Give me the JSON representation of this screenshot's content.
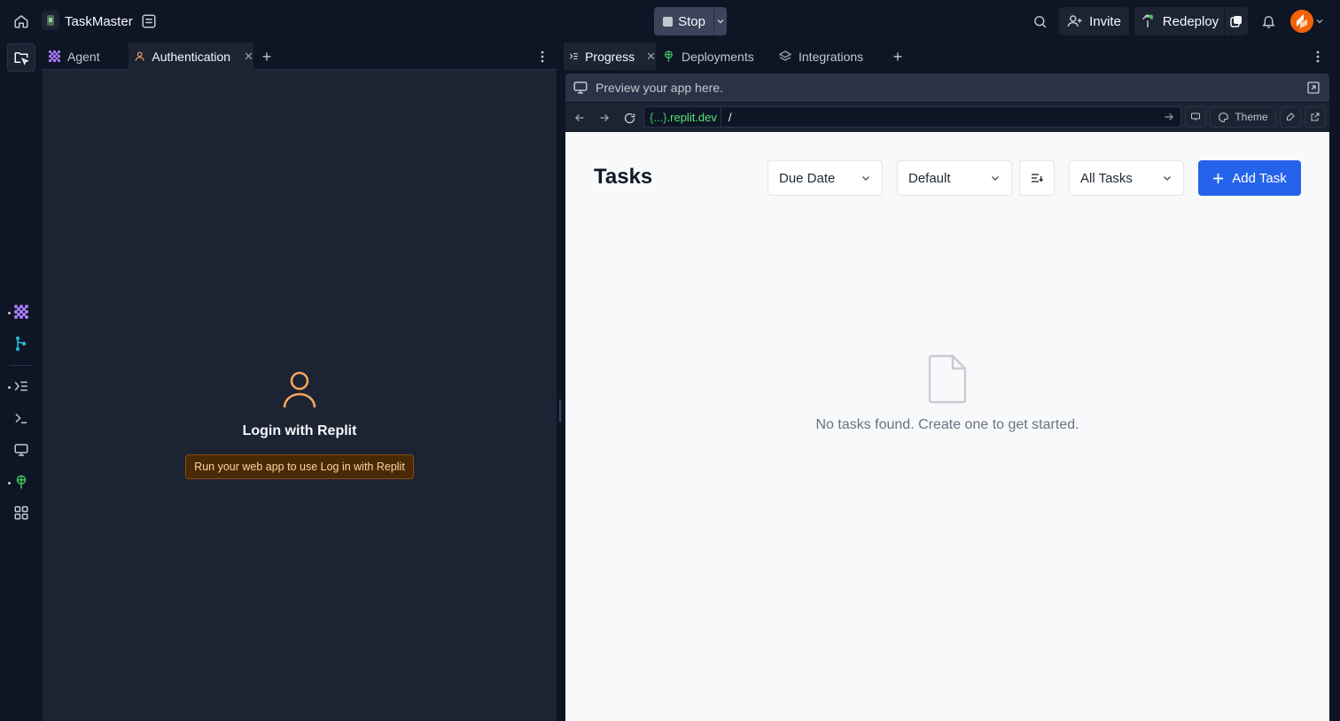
{
  "topbar": {
    "app_name": "TaskMaster",
    "stop_label": "Stop",
    "invite_label": "Invite",
    "redeploy_label": "Redeploy"
  },
  "left_pane": {
    "tabs": [
      {
        "label": "Agent",
        "icon": "agent-icon",
        "active": false
      },
      {
        "label": "Authentication",
        "icon": "user-icon",
        "active": true,
        "closable": true
      }
    ],
    "login_title": "Login with Replit",
    "login_note": "Run your web app to use Log in with Replit"
  },
  "right_pane": {
    "tabs": [
      {
        "label": "Progress",
        "icon": "progress-icon",
        "active": true,
        "closable": true
      },
      {
        "label": "Deployments",
        "icon": "deployments-icon",
        "active": false
      },
      {
        "label": "Integrations",
        "icon": "integrations-icon",
        "active": false
      }
    ],
    "preview_hint": "Preview your app here.",
    "url_host_braces": "{...}",
    "url_host_domain": ".replit.dev",
    "url_path": "/",
    "theme_label": "Theme"
  },
  "app": {
    "title": "Tasks",
    "sort_select": "Due Date",
    "order_select": "Default",
    "filter_select": "All Tasks",
    "add_button": "Add Task",
    "empty_message": "No tasks found. Create one to get started."
  },
  "colors": {
    "background": "#0e1525",
    "panel": "#1c2333",
    "accent_blue": "#2563eb",
    "url_green": "#5ae57a",
    "login_icon": "#f5a65b"
  }
}
